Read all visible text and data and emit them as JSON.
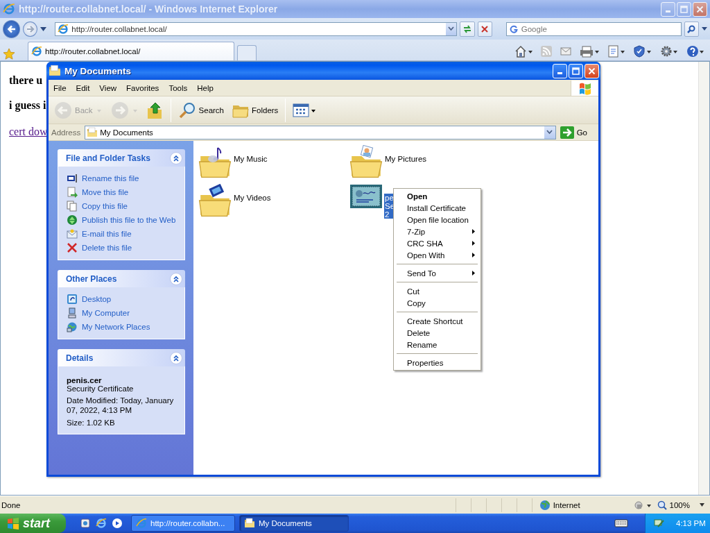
{
  "browser": {
    "title": "http://router.collabnet.local/ - Windows Internet Explorer",
    "address": "http://router.collabnet.local/",
    "search": {
      "placeholder": "Google"
    },
    "tabs": [
      {
        "label": "http://router.collabnet.local/",
        "selected": true
      }
    ],
    "page": {
      "lines": [
        {
          "kind": "heading",
          "text": "there u"
        },
        {
          "kind": "heading",
          "text": "i guess i"
        },
        {
          "kind": "link",
          "text": "cert dow"
        }
      ]
    },
    "status_bar": {
      "text": "Done",
      "zone": "Internet",
      "zoom": "100%"
    }
  },
  "explorer": {
    "title": "My Documents",
    "menu": [
      "File",
      "Edit",
      "View",
      "Favorites",
      "Tools",
      "Help"
    ],
    "toolbar": [
      {
        "kind": "back",
        "label": "Back",
        "disabled": true
      },
      {
        "kind": "forward",
        "disabled": true
      },
      {
        "kind": "up",
        "disabled": false
      },
      {
        "kind": "separator"
      },
      {
        "kind": "search",
        "label": "Search",
        "disabled": false
      },
      {
        "kind": "folders",
        "label": "Folders",
        "disabled": false
      },
      {
        "kind": "separator"
      },
      {
        "kind": "views",
        "disabled": false
      }
    ],
    "address": {
      "label": "Address",
      "value": "My Documents",
      "go": "Go"
    },
    "panels": [
      {
        "kind": "links",
        "title": "File and Folder Tasks",
        "expanded": true,
        "items": [
          {
            "kind": "rename",
            "label": "Rename this file"
          },
          {
            "kind": "move",
            "label": "Move this file"
          },
          {
            "kind": "copy",
            "label": "Copy this file"
          },
          {
            "kind": "publish",
            "label": "Publish this file to the Web"
          },
          {
            "kind": "email",
            "label": "E-mail this file"
          },
          {
            "kind": "delete",
            "label": "Delete this file"
          }
        ]
      },
      {
        "kind": "links",
        "title": "Other Places",
        "expanded": true,
        "items": [
          {
            "kind": "desktop",
            "label": "Desktop"
          },
          {
            "kind": "computer",
            "label": "My Computer"
          },
          {
            "kind": "network",
            "label": "My Network Places"
          }
        ]
      },
      {
        "kind": "details",
        "title": "Details",
        "expanded": true,
        "name": "penis.cer",
        "type": "Security Certificate",
        "lines": [
          "Date Modified: Today, January 07, 2022, 4:13 PM",
          "Size: 1.02 KB"
        ]
      }
    ],
    "items": [
      {
        "kind": "music",
        "lines": [
          "My Music"
        ],
        "selected": false
      },
      {
        "kind": "pictures",
        "lines": [
          "My Pictures"
        ],
        "selected": false
      },
      {
        "kind": "videos",
        "lines": [
          "My Videos"
        ],
        "selected": false
      },
      {
        "kind": "certificate",
        "lines": [
          "pe",
          "Se",
          "2"
        ],
        "selected": true
      }
    ]
  },
  "context_menu": {
    "items": [
      {
        "kind": "item",
        "label": "Open",
        "default": true,
        "submenu": false
      },
      {
        "kind": "item",
        "label": "Install Certificate",
        "default": false,
        "submenu": false
      },
      {
        "kind": "item",
        "label": "Open file location",
        "default": false,
        "submenu": false
      },
      {
        "kind": "item",
        "label": "7-Zip",
        "default": false,
        "submenu": true
      },
      {
        "kind": "item",
        "label": "CRC SHA",
        "default": false,
        "submenu": true
      },
      {
        "kind": "item",
        "label": "Open With",
        "default": false,
        "submenu": true
      },
      {
        "kind": "separator"
      },
      {
        "kind": "item",
        "label": "Send To",
        "default": false,
        "submenu": true
      },
      {
        "kind": "separator"
      },
      {
        "kind": "item",
        "label": "Cut",
        "default": false,
        "submenu": false
      },
      {
        "kind": "item",
        "label": "Copy",
        "default": false,
        "submenu": false
      },
      {
        "kind": "separator"
      },
      {
        "kind": "item",
        "label": "Create Shortcut",
        "default": false,
        "submenu": false
      },
      {
        "kind": "item",
        "label": "Delete",
        "default": false,
        "submenu": false
      },
      {
        "kind": "item",
        "label": "Rename",
        "default": false,
        "submenu": false
      },
      {
        "kind": "separator"
      },
      {
        "kind": "item",
        "label": "Properties",
        "default": false,
        "submenu": false
      }
    ]
  },
  "taskbar": {
    "start": "start",
    "tasks": [
      {
        "kind": "browser",
        "label": "http://router.collabn...",
        "selected": false
      },
      {
        "kind": "folder",
        "label": "My Documents",
        "selected": true
      }
    ],
    "clock": "4:13 PM"
  }
}
